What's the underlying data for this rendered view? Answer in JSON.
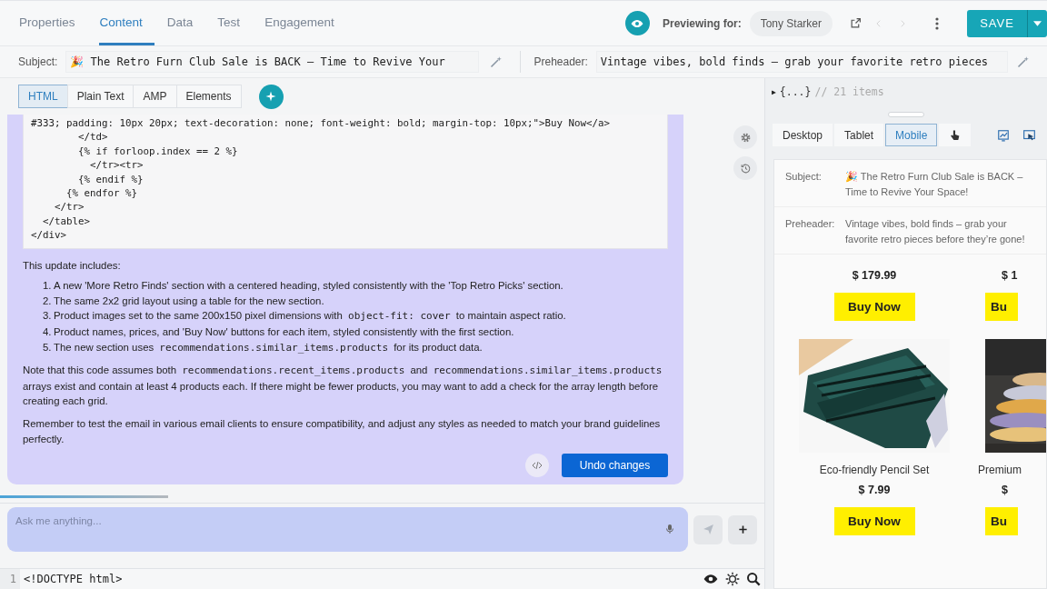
{
  "tabs": [
    {
      "label": "Properties",
      "selected": false
    },
    {
      "label": "Content",
      "selected": true
    },
    {
      "label": "Data",
      "selected": false
    },
    {
      "label": "Test",
      "selected": false
    },
    {
      "label": "Engagement",
      "selected": false
    }
  ],
  "preview": {
    "label": "Previewing for:",
    "recipient": "Tony Starker"
  },
  "save_button": "SAVE",
  "subject": {
    "label": "Subject:",
    "value": "🎉 The Retro Furn Club Sale is BACK – Time to Revive Your"
  },
  "preheader": {
    "label": "Preheader:",
    "value": "Vintage vibes, bold finds – grab your favorite retro pieces"
  },
  "format_tabs": [
    {
      "label": "HTML",
      "selected": true
    },
    {
      "label": "Plain Text",
      "selected": false
    },
    {
      "label": "AMP",
      "selected": false
    },
    {
      "label": "Elements",
      "selected": false
    }
  ],
  "chat": {
    "code_lines": [
      "#333; padding: 10px 20px; text-decoration: none; font-weight: bold; margin-top: 10px;\">Buy Now</a>",
      "        </td>",
      "        {% if forloop.index == 2 %}",
      "          </tr><tr>",
      "        {% endif %}",
      "      {% endfor %}",
      "    </tr>",
      "  </table>",
      "</div>"
    ],
    "intro": "This update includes:",
    "list": [
      {
        "number": "1.",
        "parts": [
          {
            "text": "A new 'More Retro Finds' section with a centered heading, styled consistently with the 'Top Retro Picks' section."
          }
        ]
      },
      {
        "number": "2.",
        "parts": [
          {
            "text": "The same 2x2 grid layout using a table for the new section."
          }
        ]
      },
      {
        "number": "3.",
        "parts": [
          {
            "text": "Product images set to the same 200x150 pixel dimensions with "
          },
          {
            "text": "object-fit: cover",
            "code": true
          },
          {
            "text": " to maintain aspect ratio."
          }
        ]
      },
      {
        "number": "4.",
        "parts": [
          {
            "text": "Product names, prices, and 'Buy Now' buttons for each item, styled consistently with the first section."
          }
        ]
      },
      {
        "number": "5.",
        "parts": [
          {
            "text": "The new section uses "
          },
          {
            "text": "recommendations.similar_items.products",
            "code": true
          },
          {
            "text": " for its product data."
          }
        ]
      }
    ],
    "paragraphs": [
      [
        {
          "text": "Note that this code assumes both "
        },
        {
          "text": "recommendations.recent_items.products",
          "code": true
        },
        {
          "text": " and "
        },
        {
          "text": "recommendations.similar_items.products",
          "code": true
        },
        {
          "text": " arrays exist and contain at least 4 products each. If there might be fewer products, you may want to add a check for the array length before creating each grid."
        }
      ],
      [
        {
          "text": "Remember to test the email in various email clients to ensure compatibility, and adjust any styles as needed to match your brand guidelines perfectly."
        }
      ]
    ],
    "undo_button": "Undo changes"
  },
  "progress": {
    "level": 0.22
  },
  "ask": {
    "placeholder": "Ask me anything..."
  },
  "editor": {
    "line_number": "1",
    "line": "<!DOCTYPE html>"
  },
  "json_preview": {
    "toggle": "▶",
    "value": "{...}",
    "comment": "// 21 items"
  },
  "device_tabs": [
    {
      "label": "Desktop",
      "selected": false
    },
    {
      "label": "Tablet",
      "selected": false
    },
    {
      "label": "Mobile",
      "selected": true
    }
  ],
  "email_preview": {
    "fields": [
      {
        "label": "Subject:",
        "value": "🎉 The Retro Furn Club Sale is BACK – Time to Revive Your Space!"
      },
      {
        "label": "Preheader:",
        "value": "Vintage vibes, bold finds – grab your favorite retro pieces before they’re gone!"
      }
    ],
    "product_rows": [
      [
        {
          "price": "$ 179.99",
          "button": "Buy Now"
        },
        {
          "price": "$ 1",
          "button": "Bu"
        }
      ],
      [
        {
          "name": "Eco-friendly Pencil Set",
          "price": "$ 7.99",
          "button": "Buy Now"
        },
        {
          "name": "Premium",
          "price": "$",
          "button": "Bu"
        }
      ]
    ]
  }
}
